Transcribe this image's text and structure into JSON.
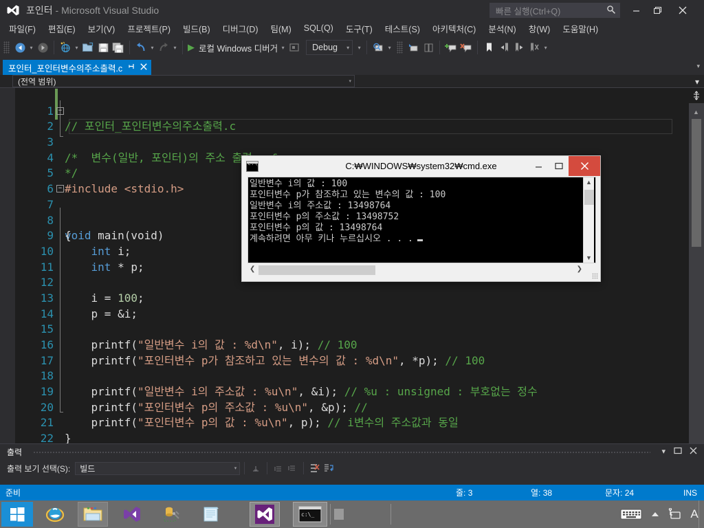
{
  "titlebar": {
    "project": "포인터",
    "suffix": " - Microsoft Visual Studio",
    "quick_launch_placeholder": "빠른 실행(Ctrl+Q)",
    "minimize": "—",
    "maximize": "❐",
    "close": "✕"
  },
  "menu": [
    {
      "label": "파일(F)"
    },
    {
      "label": "편집(E)"
    },
    {
      "label": "보기(V)"
    },
    {
      "label": "프로젝트(P)"
    },
    {
      "label": "빌드(B)"
    },
    {
      "label": "디버그(D)"
    },
    {
      "label": "팀(M)"
    },
    {
      "label": "SQL(Q)"
    },
    {
      "label": "도구(T)"
    },
    {
      "label": "테스트(S)"
    },
    {
      "label": "아키텍처(C)"
    },
    {
      "label": "분석(N)"
    },
    {
      "label": "창(W)"
    },
    {
      "label": "도움말(H)"
    }
  ],
  "toolbar": {
    "run_label": "로컬 Windows 디버거",
    "config": "Debug"
  },
  "tab": {
    "name": "포인터_포인터변수의주소출력.c",
    "pin": "⊣",
    "close": "✕"
  },
  "scope": {
    "value": "(전역 범위)"
  },
  "editor": {
    "lines": [
      {
        "n": "1",
        "text": "// 포인터_포인터변수의주소출력.c",
        "kind": "comment",
        "changed": true
      },
      {
        "n": "2",
        "text": "/*",
        "kind": "comment",
        "changed": true,
        "fold": true
      },
      {
        "n": "3",
        "text": "    변수(일반, 포인터)의 주소 출력 : &",
        "kind": "comment",
        "current": true
      },
      {
        "n": "4",
        "text": "*/",
        "kind": "comment"
      },
      {
        "n": "5",
        "text": "#include <stdio.h>",
        "kind": "preproc"
      },
      {
        "n": "6",
        "text": "",
        "kind": "plain"
      },
      {
        "n": "7",
        "text": "void main(void)",
        "kind": "decl",
        "fold": true
      },
      {
        "n": "8",
        "text": "{",
        "kind": "plain"
      },
      {
        "n": "9",
        "text": "    int i;",
        "kind": "decl_int"
      },
      {
        "n": "10",
        "text": "    int * p;",
        "kind": "decl_ptr"
      },
      {
        "n": "11",
        "text": "",
        "kind": "plain"
      },
      {
        "n": "12",
        "text": "    i = 100;",
        "kind": "assign_i"
      },
      {
        "n": "13",
        "text": "    p = &i;",
        "kind": "assign_p"
      },
      {
        "n": "14",
        "text": "",
        "kind": "plain"
      },
      {
        "n": "15",
        "text": "    printf(\"일반변수 i의 값 : %d\\n\", i); // 100",
        "kind": "printf1"
      },
      {
        "n": "16",
        "text": "    printf(\"포인터변수 p가 참조하고 있는 변수의 값 : %d\\n\", *p); // 100",
        "kind": "printf2"
      },
      {
        "n": "17",
        "text": "",
        "kind": "plain"
      },
      {
        "n": "18",
        "text": "    printf(\"일반변수 i의 주소값 : %u\\n\", &i); // %u : unsigned : 부호없는 정수",
        "kind": "printf3"
      },
      {
        "n": "19",
        "text": "    printf(\"포인터변수 p의 주소값 : %u\\n\", &p); //",
        "kind": "printf4"
      },
      {
        "n": "20",
        "text": "    printf(\"포인터변수 p의 값 : %u\\n\", p); // i변수의 주소값과 동일",
        "kind": "printf5"
      },
      {
        "n": "21",
        "text": "}",
        "kind": "plain"
      },
      {
        "n": "22",
        "text": "",
        "kind": "plain"
      }
    ],
    "code_parts": {
      "l1_comment": "// 포인터_포인터변수의주소출력.c",
      "l2_comment": "/*",
      "l3_comment": "    변수(일반, 포인터)의 주소 출력 : &",
      "l4_comment": "*/",
      "l5_hash": "#include ",
      "l5_header": "<stdio.h>",
      "l7_kw": "void",
      "l7_rest": " main(void)",
      "l8": "{",
      "l9_kw": "    int",
      "l9_rest": " i;",
      "l10_kw": "    int",
      "l10_rest": " * p;",
      "l12_pre": "    i = ",
      "l12_num": "100",
      "l12_post": ";",
      "l13": "    p = &i;",
      "l15_fn": "    printf(",
      "l15_str": "\"일반변수 i의 값 : %d\\n\"",
      "l15_mid": ", i); ",
      "l15_cm": "// 100",
      "l16_fn": "    printf(",
      "l16_str": "\"포인터변수 p가 참조하고 있는 변수의 값 : %d\\n\"",
      "l16_mid": ", *p); ",
      "l16_cm": "// 100",
      "l18_fn": "    printf(",
      "l18_str": "\"일반변수 i의 주소값 : %u\\n\"",
      "l18_mid": ", &i); ",
      "l18_cm": "// %u : unsigned : 부호없는 정수",
      "l19_fn": "    printf(",
      "l19_str": "\"포인터변수 p의 주소값 : %u\\n\"",
      "l19_mid": ", &p); ",
      "l19_cm": "//",
      "l20_fn": "    printf(",
      "l20_str": "\"포인터변수 p의 값 : %u\\n\"",
      "l20_mid": ", p); ",
      "l20_cm": "// i변수의 주소값과 동일",
      "l21": "}"
    }
  },
  "console": {
    "title": "C:₩WINDOWS₩system32₩cmd.exe",
    "minimize": "—",
    "maximize": "❐",
    "close": "✕",
    "output_lines": [
      "일반변수 i의 값 : 100",
      "포인터변수 p가 참조하고 있는 변수의 값 : 100",
      "일반변수 i의 주소값 : 13498764",
      "포인터변수 p의 주소값 : 13498752",
      "포인터변수 p의 값 : 13498764",
      "계속하려면 아무 키나 누르십시오 . . ."
    ]
  },
  "output_pane": {
    "title": "출력",
    "select_label": "출력 보기 선택(S):",
    "selected": "빌드",
    "dock_icon": "❐",
    "close_icon": "✕",
    "menu_icon": "▾"
  },
  "statusbar": {
    "ready": "준비",
    "line": "줄: 3",
    "column": "열: 38",
    "chars": "문자: 24",
    "insert_mode": "INS"
  },
  "taskbar": {
    "items": [
      {
        "name": "start-button",
        "glyph": "windows"
      },
      {
        "name": "internet-explorer",
        "glyph": "ie"
      },
      {
        "name": "file-explorer",
        "glyph": "folder"
      },
      {
        "name": "visual-studio",
        "glyph": "vs"
      },
      {
        "name": "sql-tools",
        "glyph": "tools"
      },
      {
        "name": "notepad",
        "glyph": "notepad"
      },
      {
        "name": "visual-studio-running",
        "glyph": "vs-active"
      },
      {
        "name": "cmd-running",
        "glyph": "cmd"
      }
    ],
    "tray": [
      "keyboard-icon",
      "show-hidden-icon",
      "network-icon",
      "language-icon"
    ],
    "language": "A"
  },
  "colors": {
    "accent": "#007acc",
    "chrome": "#2d2d30",
    "editor_bg": "#1e1e1e",
    "comment": "#57a64a",
    "string": "#d69d85",
    "keyword": "#569cd6",
    "linenum": "#2b91af",
    "close_red": "#d44b3e"
  }
}
